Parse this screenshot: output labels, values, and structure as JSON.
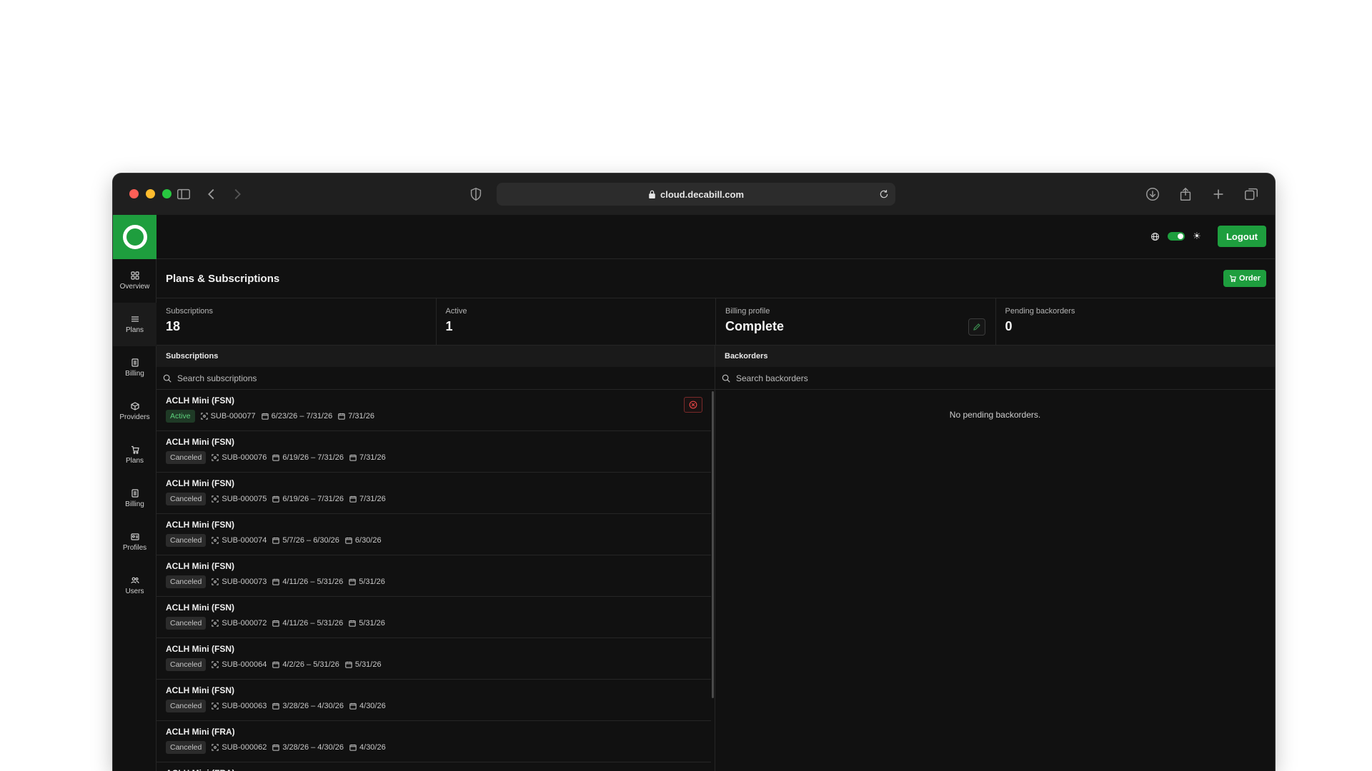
{
  "browser": {
    "url": "cloud.decabill.com"
  },
  "header": {
    "logout_label": "Logout"
  },
  "sidebar": {
    "items": [
      {
        "label": "Overview",
        "icon": "grid-icon"
      },
      {
        "label": "Plans",
        "icon": "list-icon"
      },
      {
        "label": "Billing",
        "icon": "document-icon"
      },
      {
        "label": "Providers",
        "icon": "box-icon"
      },
      {
        "label": "Plans",
        "icon": "cart-icon"
      },
      {
        "label": "Billing",
        "icon": "document-icon"
      },
      {
        "label": "Profiles",
        "icon": "id-card-icon"
      },
      {
        "label": "Users",
        "icon": "users-icon"
      }
    ]
  },
  "page": {
    "title": "Plans & Subscriptions",
    "order_label": "Order"
  },
  "stats": [
    {
      "label": "Subscriptions",
      "value": "18"
    },
    {
      "label": "Active",
      "value": "1"
    },
    {
      "label": "Billing profile",
      "value": "Complete"
    },
    {
      "label": "Pending backorders",
      "value": "0"
    }
  ],
  "subscriptions": {
    "heading": "Subscriptions",
    "search_placeholder": "Search subscriptions",
    "rows": [
      {
        "title": "ACLH Mini (FSN)",
        "status": "Active",
        "id": "SUB-000077",
        "period": "6/23/26 – 7/31/26",
        "date": "7/31/26"
      },
      {
        "title": "ACLH Mini (FSN)",
        "status": "Canceled",
        "id": "SUB-000076",
        "period": "6/19/26 – 7/31/26",
        "date": "7/31/26"
      },
      {
        "title": "ACLH Mini (FSN)",
        "status": "Canceled",
        "id": "SUB-000075",
        "period": "6/19/26 – 7/31/26",
        "date": "7/31/26"
      },
      {
        "title": "ACLH Mini (FSN)",
        "status": "Canceled",
        "id": "SUB-000074",
        "period": "5/7/26 – 6/30/26",
        "date": "6/30/26"
      },
      {
        "title": "ACLH Mini (FSN)",
        "status": "Canceled",
        "id": "SUB-000073",
        "period": "4/11/26 – 5/31/26",
        "date": "5/31/26"
      },
      {
        "title": "ACLH Mini (FSN)",
        "status": "Canceled",
        "id": "SUB-000072",
        "period": "4/11/26 – 5/31/26",
        "date": "5/31/26"
      },
      {
        "title": "ACLH Mini (FSN)",
        "status": "Canceled",
        "id": "SUB-000064",
        "period": "4/2/26 – 5/31/26",
        "date": "5/31/26"
      },
      {
        "title": "ACLH Mini (FSN)",
        "status": "Canceled",
        "id": "SUB-000063",
        "period": "3/28/26 – 4/30/26",
        "date": "4/30/26"
      },
      {
        "title": "ACLH Mini (FRA)",
        "status": "Canceled",
        "id": "SUB-000062",
        "period": "3/28/26 – 4/30/26",
        "date": "4/30/26"
      },
      {
        "title": "ACLH Mini (FRA)",
        "status": "",
        "id": "",
        "period": "",
        "date": ""
      }
    ]
  },
  "backorders": {
    "heading": "Backorders",
    "search_placeholder": "Search backorders",
    "empty_text": "No pending backorders."
  },
  "colors": {
    "accent": "#1e9e3e",
    "background": "#111111",
    "danger": "#e04444"
  }
}
